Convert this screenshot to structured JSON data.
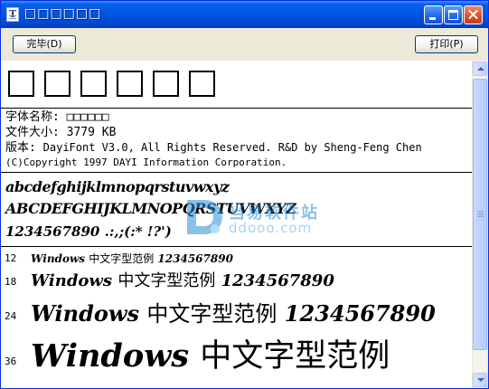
{
  "window": {
    "title": "□□□□□□",
    "icon": "font-file-icon",
    "controls": [
      "minimize-icon",
      "maximize-icon",
      "close-icon"
    ]
  },
  "toolbar": {
    "done_label": "完毕(D)",
    "print_label": "打印(P)"
  },
  "preview": {
    "glyphs": "□□□□□□"
  },
  "info": {
    "font_name_label": "字体名称:",
    "font_name_value": "□□□□□□",
    "file_size_label": "文件大小:",
    "file_size_value": "3779 KB",
    "version_label": "版本:",
    "version_value": "DayiFont V3.0, All Rights Reserved. R&D by Sheng-Feng Chen",
    "copyright": "(C)Copyright 1997 DAYI Information Corporation."
  },
  "samples": {
    "lowercase": "abcdefghijklmnopqrstuvwxyz",
    "uppercase": "ABCDEFGHIJKLMNOPQRSTUVWXYZ",
    "digits": "1234567890 .:,;(:* !?')"
  },
  "size_samples": [
    {
      "size": "12",
      "latin": "Windows",
      "cjk": "中文字型范例",
      "digits": "1234567890"
    },
    {
      "size": "18",
      "latin": "Windows",
      "cjk": "中文字型范例",
      "digits": "1234567890"
    },
    {
      "size": "24",
      "latin": "Windows",
      "cjk": "中文字型范例",
      "digits": "1234567890"
    },
    {
      "size": "36",
      "latin": "Windows",
      "cjk": "中文字型范例",
      "digits": ""
    }
  ],
  "watermark": {
    "cn": "当易软件站",
    "en": "ddooo.com"
  },
  "colors": {
    "titlebar": "#0054e3",
    "window_face": "#ece9d8",
    "close_button": "#e0502d",
    "watermark": "#2b8fd8"
  }
}
